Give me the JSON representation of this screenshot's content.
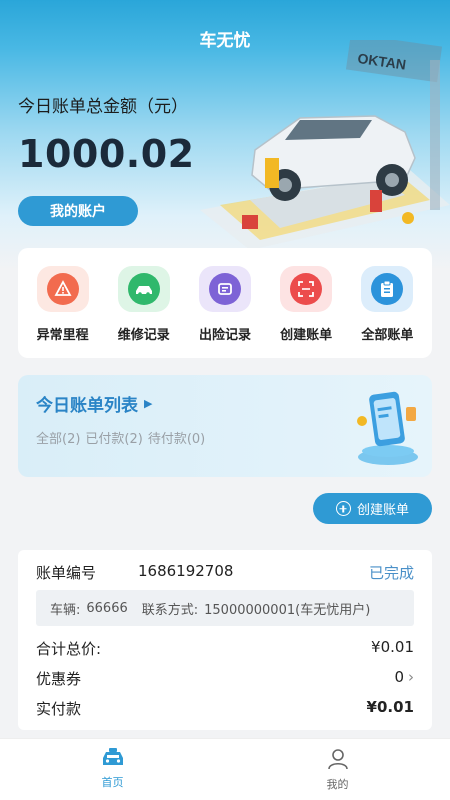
{
  "app": {
    "title": "车无忧"
  },
  "summary": {
    "total_label": "今日账单总金额（元）",
    "total_amount": "1000.02",
    "account_button": "我的账户"
  },
  "scene": {
    "sign_text": "OKTAN"
  },
  "quick_actions": [
    {
      "label": "异常里程",
      "icon": "mileage-alert-icon",
      "color": "#e8583c"
    },
    {
      "label": "维修记录",
      "icon": "repair-car-icon",
      "color": "#2fb46a"
    },
    {
      "label": "出险记录",
      "icon": "accident-car-icon",
      "color": "#7a5fd0"
    },
    {
      "label": "创建账单",
      "icon": "scan-icon",
      "color": "#e84a4a"
    },
    {
      "label": "全部账单",
      "icon": "clipboard-icon",
      "color": "#2a8fd6"
    }
  ],
  "today_bills": {
    "title": "今日账单列表",
    "all": "全部(2)",
    "paid": "已付款(2)",
    "unpaid": "待付款(0)"
  },
  "create_bill_button": "创建账单",
  "order": {
    "number_label": "账单编号",
    "number": "1686192708",
    "status": "已完成",
    "vehicle_label": "车辆:",
    "vehicle": "66666",
    "contact_label": "联系方式:",
    "contact": "15000000001(车无忧用户)",
    "total_label": "合计总价:",
    "total": "¥0.01",
    "coupon_label": "优惠券",
    "coupon": "0",
    "paid_label": "实付款",
    "paid": "¥0.01"
  },
  "tabs": [
    {
      "label": "首页",
      "active": true,
      "color": "#2f9ad4"
    },
    {
      "label": "我的",
      "active": false,
      "color": "#666666"
    }
  ]
}
